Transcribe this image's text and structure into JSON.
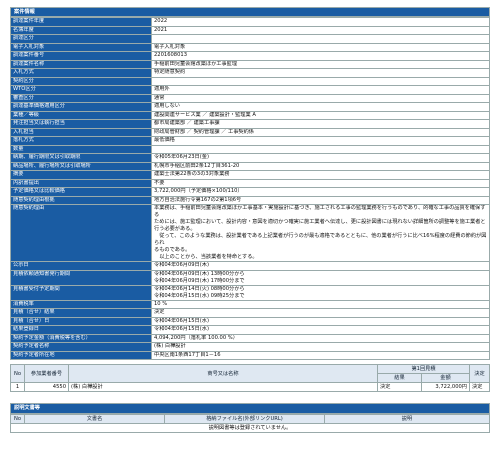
{
  "header": {
    "title": "案件情報"
  },
  "info_rows": [
    {
      "label": "調達案件年度",
      "value": "2022"
    },
    {
      "label": "名簿年度",
      "value": "2021"
    },
    {
      "label": "調達区分",
      "value": ""
    },
    {
      "label": "電子入札対象",
      "value": "電子入札対象"
    },
    {
      "label": "調達案件番号",
      "value": "2201608013"
    },
    {
      "label": "調達案件名称",
      "value": "手稲前田児童会館改築ほか工事監理"
    },
    {
      "label": "入札方式",
      "value": "特定随意契約"
    },
    {
      "label": "契約区分",
      "value": ""
    },
    {
      "label": "WTO区分",
      "value": "適用外"
    },
    {
      "label": "審査区分",
      "value": "通常"
    },
    {
      "label": "調達基準価格適用区分",
      "value": "適用しない"
    },
    {
      "label": "業種／等級",
      "value": "建設関連サービス業 ／ 建築設計・監理業 A"
    },
    {
      "label": "発注担当又は執行担当",
      "value": "都市局建築部 ／ 建築工事課"
    },
    {
      "label": "入札担当",
      "value": "財政局管財部 ／ 契約管理課 ／ 工事契約係"
    },
    {
      "label": "落札方式",
      "value": "最低価格"
    },
    {
      "label": "数量",
      "value": ""
    },
    {
      "label": "納期、履行期限又は引取期限",
      "value": "令和05年06月23日(金)"
    },
    {
      "label": "納品場所、履行場所又は引取場所",
      "value": "札幌市手稲区前田2条12丁目361-20"
    },
    {
      "label": "摘要",
      "value": "建築士法第22条の3の3対象業務"
    },
    {
      "label": "内訳書提出",
      "value": "不要"
    },
    {
      "label": "予定価格又は比較価格",
      "value": "3,722,000円（予定価格×100/110）"
    },
    {
      "label": "随意契約理由根拠",
      "value": "地方自治法施行令第167の2第1項6号"
    }
  ],
  "reason": {
    "label": "随意契約理由",
    "lines": [
      "本業務は、手稲前田児童会館改築ほか工事基本・実施設計に基づき、施工される工事の監理業務を行うものであり、的確な工事の品質を確保する",
      "ためには、施工監理において、設計内容・意図を適切かつ確実に施工業者へ伝達し、更に設計図書には現れない詳細箇所の調整等を施工業者と",
      "行う必要がある。",
      "　従って、このような業務は、設計業者である上記業者が行うのが最も適格であるとともに、他の業者が行うに比べ16%程度の経費の節約が図られ",
      "るものである。",
      "　以上のことから、当該業者を特命とする。"
    ]
  },
  "schedule_rows": [
    {
      "label": "公示日",
      "lines": [
        "令和04年06月09日(木)"
      ]
    },
    {
      "label": "見積依頼通知書発行期間",
      "lines": [
        "令和04年06月09日(木) 13時00分から",
        "令和04年06月09日(木) 17時00分まで"
      ]
    },
    {
      "label": "見積書受付予定期間",
      "lines": [
        "令和04年06月14日(火) 08時00分から",
        "令和04年06月15日(水) 09時25分まで"
      ]
    },
    {
      "label": "消費税率",
      "lines": [
        "10 %"
      ]
    },
    {
      "label": "見積（合せ）結果",
      "lines": [
        "決定"
      ]
    },
    {
      "label": "見積（合せ）日",
      "lines": [
        "令和04年06月15日(水)"
      ]
    },
    {
      "label": "結果登録日",
      "lines": [
        "令和04年06月15日(水)"
      ]
    },
    {
      "label": "契約予定金額（消費税等を含む）",
      "lines": [
        "4,094,200円（落札率 100.00 %）"
      ]
    },
    {
      "label": "契約予定者名称",
      "lines": [
        "(株) 白樺設計"
      ]
    },
    {
      "label": "契約予定者所在地",
      "lines": [
        "中央区南1条西17丁目1－16"
      ]
    }
  ],
  "bid_table": {
    "headers": {
      "no": "No",
      "bidder_no": "参加業者番号",
      "bidder_name": "商号又は名称",
      "round": "第1回見積",
      "result": "結果",
      "amount": "金額",
      "decision": "決定"
    },
    "rows": [
      {
        "no": "1",
        "bidder_no": "4550",
        "bidder_name": "(株) 白樺設計",
        "result": "決定",
        "amount": "3,722,000円",
        "decision": "決定"
      }
    ]
  },
  "doc_section": {
    "title": "説明文書等",
    "headers": {
      "no": "No",
      "name": "文書名",
      "file": "格納ファイル名(外部リンクURL)",
      "desc": "説明"
    },
    "empty_message": "説明図書等は登録されていません。"
  }
}
